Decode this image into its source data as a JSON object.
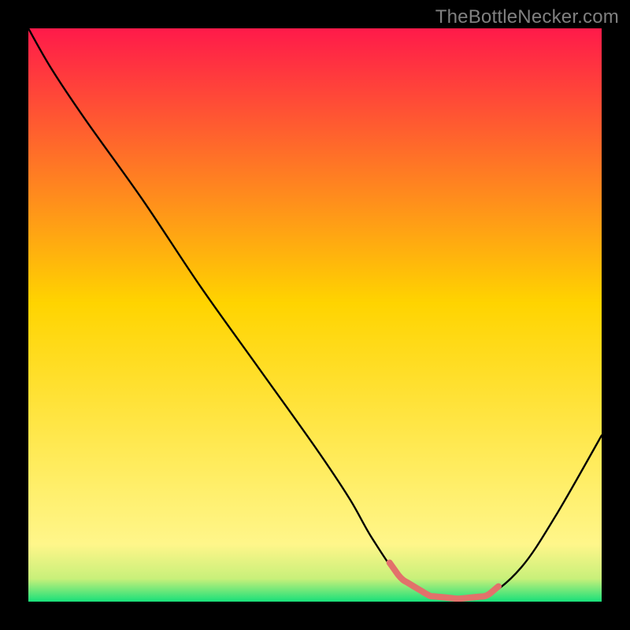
{
  "attribution": "TheBottleNecker.com",
  "colors": {
    "frame": "#000000",
    "line": "#000000",
    "highlight": "#e2716b",
    "grad_top": "#ff1a4a",
    "grad_mid": "#ffd400",
    "grad_low": "#fff68a",
    "grad_bottom": "#18e07a",
    "attribution": "#808080"
  },
  "chart_data": {
    "type": "line",
    "title": "",
    "xlabel": "",
    "ylabel": "",
    "xlim": [
      0,
      100
    ],
    "ylim": [
      0,
      100
    ],
    "x": [
      0,
      4,
      10,
      20,
      30,
      40,
      50,
      56,
      60,
      65,
      70,
      75,
      80,
      86,
      92,
      100
    ],
    "values": [
      100,
      93,
      84,
      70,
      55,
      41,
      27,
      18,
      11,
      4,
      1,
      0.5,
      1,
      6,
      15,
      29
    ],
    "highlight_region": {
      "x_start": 63,
      "x_end": 82
    }
  }
}
